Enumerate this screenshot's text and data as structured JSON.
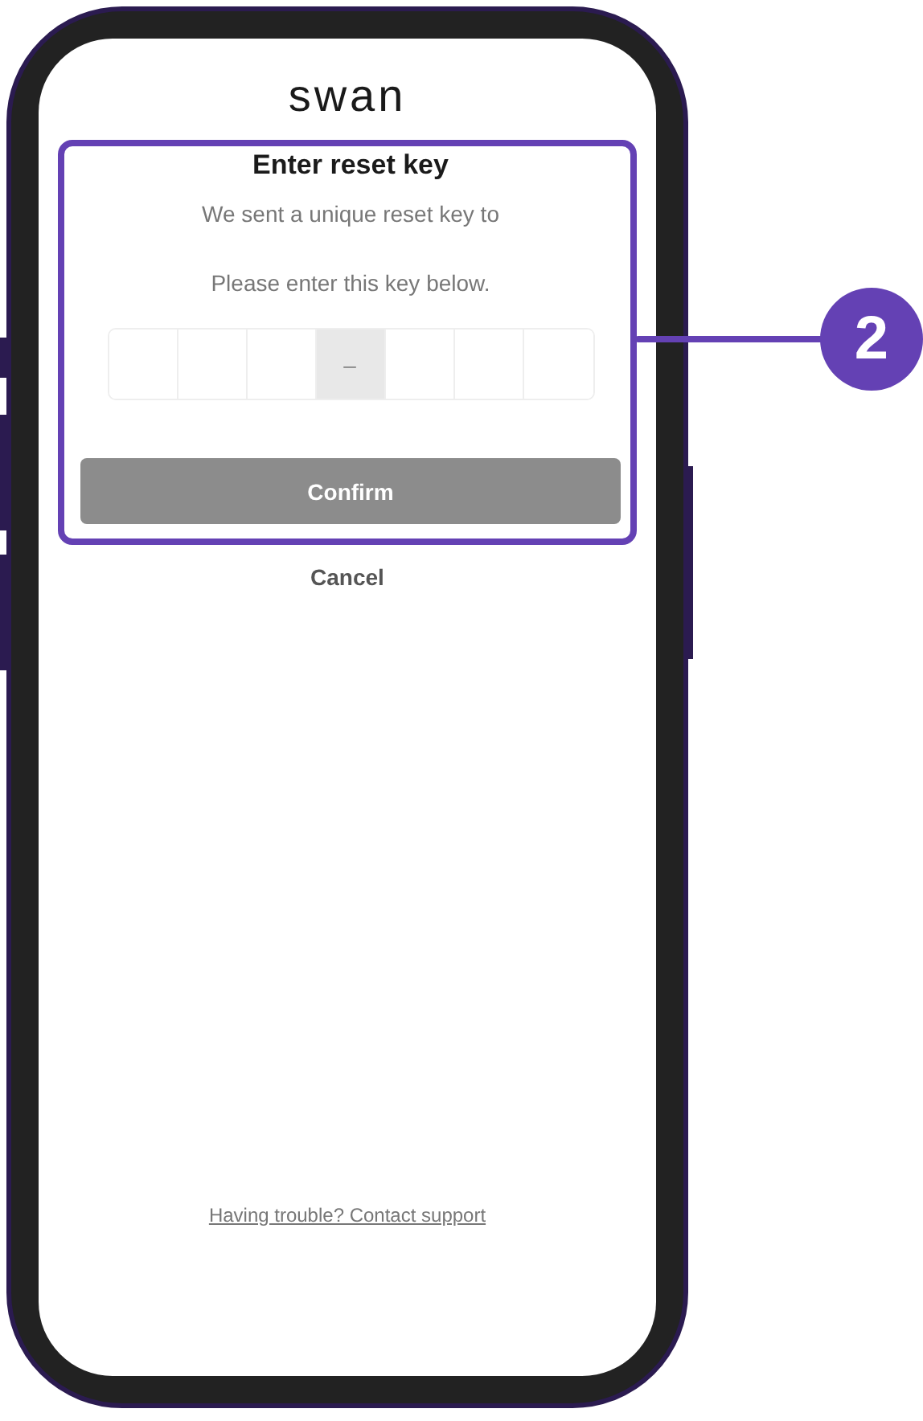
{
  "app": {
    "logo": "swan"
  },
  "reset_key_dialog": {
    "title": "Enter reset key",
    "message": "We sent a unique reset key to",
    "instruction": "Please enter this key below.",
    "key_cells": [
      {
        "kind": "digit"
      },
      {
        "kind": "digit"
      },
      {
        "kind": "digit"
      },
      {
        "kind": "separator",
        "text": "–"
      },
      {
        "kind": "digit"
      },
      {
        "kind": "digit"
      },
      {
        "kind": "digit"
      }
    ],
    "confirm_button": {
      "label": "Confirm",
      "disabled": true
    }
  },
  "cancel_link": "Cancel",
  "support_link": "Having trouble? Contact support",
  "callout": {
    "number": "2"
  }
}
